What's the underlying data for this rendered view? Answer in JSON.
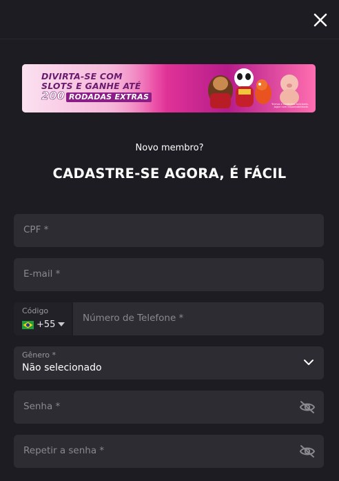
{
  "banner": {
    "line1": "DIVIRTA-SE COM",
    "line2": "SLOTS E GANHE ATÉ",
    "number": "200",
    "extras": "RODADAS EXTRAS",
    "fine_print": "Termos e condições aplicáveis. Jogue com responsabilidade."
  },
  "header": {
    "subtitle": "Novo membro?",
    "title": "CADASTRE-SE AGORA, É FÁCIL"
  },
  "form": {
    "cpf_placeholder": "CPF *",
    "email_placeholder": "E-mail *",
    "code_label": "Código",
    "code_value": "+55",
    "phone_placeholder": "Número de Telefone *",
    "gender_label": "Gênero *",
    "gender_value": "Não selecionado",
    "password_placeholder": "Senha *",
    "repeat_password_placeholder": "Repetir a senha *"
  },
  "icons": {
    "close": "close-icon",
    "flag": "brazil-flag-icon",
    "caret": "caret-down-icon",
    "chevron": "chevron-down-icon",
    "eye": "eye-off-icon"
  },
  "colors": {
    "background": "#1d1c22",
    "field": "#2d2c33",
    "placeholder": "#8a8990"
  }
}
